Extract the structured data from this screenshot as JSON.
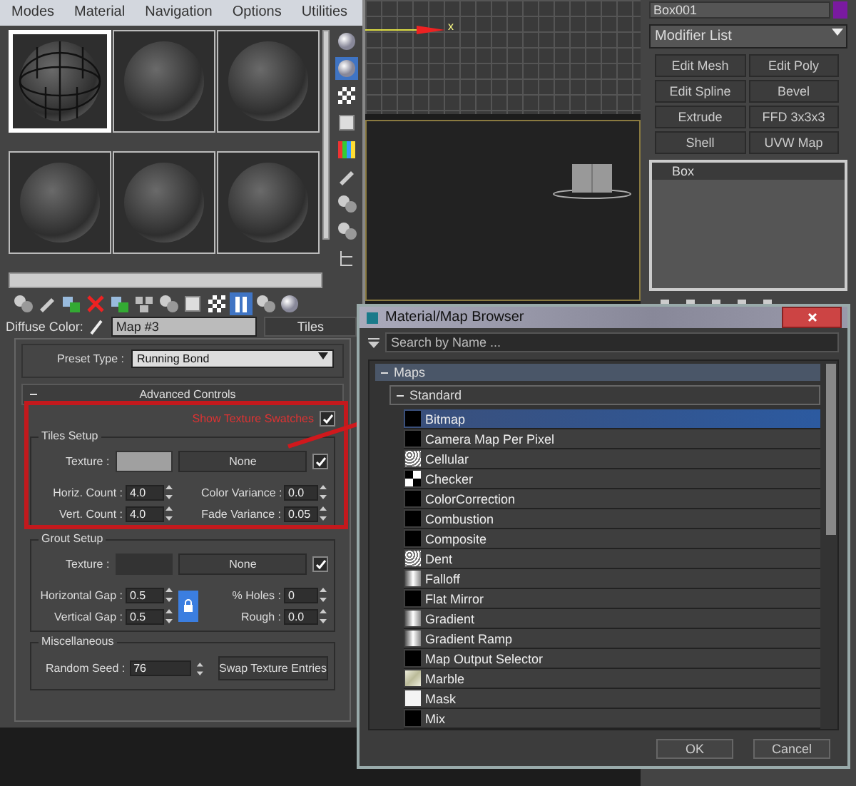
{
  "menu": [
    "Modes",
    "Material",
    "Navigation",
    "Options",
    "Utilities"
  ],
  "sample_slots": [
    {
      "kind": "tiled",
      "selected": true
    },
    {
      "kind": "plain",
      "selected": false
    },
    {
      "kind": "plain",
      "selected": false
    },
    {
      "kind": "plain",
      "selected": false
    },
    {
      "kind": "plain",
      "selected": false
    },
    {
      "kind": "plain",
      "selected": false
    }
  ],
  "diffuse": {
    "label": "Diffuse Color:",
    "map": "Map #3",
    "type": "Tiles"
  },
  "preset": {
    "label": "Preset Type :",
    "value": "Running Bond"
  },
  "advanced": {
    "title": "Advanced Controls",
    "expanded": true,
    "show_swatches": {
      "label": "Show Texture Swatches",
      "checked": true
    }
  },
  "tiles_setup": {
    "title": "Tiles Setup",
    "texture_label": "Texture :",
    "texture_map": "None",
    "texture_on": true,
    "fields": [
      {
        "label": "Horiz. Count :",
        "value": "4.0"
      },
      {
        "label": "Color Variance :",
        "value": "0.0"
      },
      {
        "label": "Vert. Count :",
        "value": "4.0"
      },
      {
        "label": "Fade Variance :",
        "value": "0.05"
      }
    ]
  },
  "grout_setup": {
    "title": "Grout Setup",
    "texture_label": "Texture :",
    "texture_map": "None",
    "texture_on": true,
    "lock": {
      "on": true
    },
    "fields": [
      {
        "label": "Horizontal Gap :",
        "value": "0.5"
      },
      {
        "label": "% Holes :",
        "value": "0"
      },
      {
        "label": "Vertical Gap :",
        "value": "0.5"
      },
      {
        "label": "Rough :",
        "value": "0.0"
      }
    ]
  },
  "misc": {
    "title": "Miscellaneous",
    "seed_label": "Random Seed :",
    "seed": "76",
    "button": "Swap Texture Entries"
  },
  "viewport": {
    "axis_label": "x"
  },
  "command_panel": {
    "object_name": "Box001",
    "modifier_list": "Modifier List",
    "modifiers": [
      "Edit Mesh",
      "Edit Poly",
      "Edit Spline",
      "Bevel",
      "Extrude",
      "FFD 3x3x3",
      "Shell",
      "UVW Map"
    ],
    "stack": [
      {
        "label": "Box",
        "selected": true
      }
    ]
  },
  "browser": {
    "title": "Material/Map Browser",
    "search_placeholder": "Search by Name ...",
    "groups": [
      {
        "label": "Maps",
        "expanded": true,
        "children": [
          {
            "label": "Standard",
            "expanded": true,
            "items": [
              {
                "label": "Bitmap",
                "kind": "black",
                "selected": true
              },
              {
                "label": "Camera Map Per Pixel",
                "kind": "black",
                "selected": false
              },
              {
                "label": "Cellular",
                "kind": "noise",
                "selected": false
              },
              {
                "label": "Checker",
                "kind": "checker",
                "selected": false
              },
              {
                "label": "ColorCorrection",
                "kind": "black",
                "selected": false
              },
              {
                "label": "Combustion",
                "kind": "black",
                "selected": false
              },
              {
                "label": "Composite",
                "kind": "black",
                "selected": false
              },
              {
                "label": "Dent",
                "kind": "noise",
                "selected": false
              },
              {
                "label": "Falloff",
                "kind": "gradient",
                "selected": false
              },
              {
                "label": "Flat Mirror",
                "kind": "black",
                "selected": false
              },
              {
                "label": "Gradient",
                "kind": "gradient",
                "selected": false
              },
              {
                "label": "Gradient Ramp",
                "kind": "gradient",
                "selected": false
              },
              {
                "label": "Map Output Selector",
                "kind": "black",
                "selected": false
              },
              {
                "label": "Marble",
                "kind": "marble",
                "selected": false
              },
              {
                "label": "Mask",
                "kind": "white",
                "selected": false
              },
              {
                "label": "Mix",
                "kind": "black",
                "selected": false
              }
            ]
          }
        ]
      }
    ],
    "buttons": [
      "OK",
      "Cancel"
    ]
  }
}
